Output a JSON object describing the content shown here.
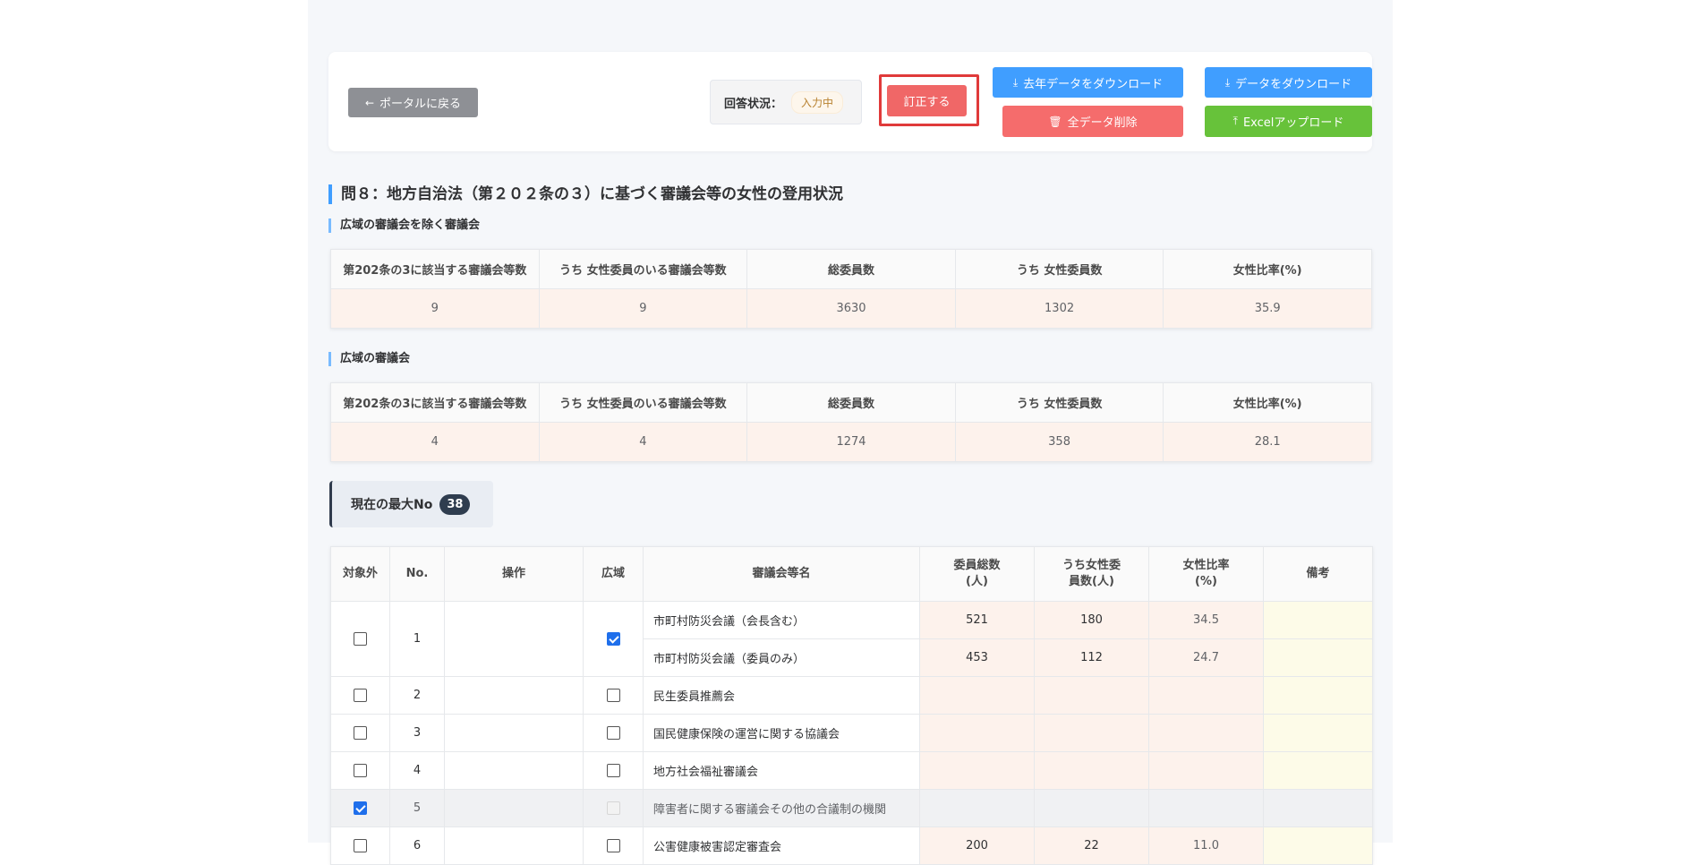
{
  "toolbar": {
    "back_label": "ポータルに戻る",
    "status_label": "回答状況：",
    "status_value": "入力中",
    "correct_label": "訂正する",
    "download_last_year_label": "去年データをダウンロード",
    "delete_all_label": "全データ削除",
    "download_label": "データをダウンロード",
    "excel_upload_label": "Excelアップロード"
  },
  "section": {
    "title": "問８：地方自治法（第２０２条の３）に基づく審議会等の女性の登用状況"
  },
  "summary_headers": [
    "第202条の3に該当する審議会等数",
    "うち 女性委員のいる審議会等数",
    "総委員数",
    "うち 女性委員数",
    "女性比率(%)"
  ],
  "summary_non_wide": {
    "title": "広域の審議会を除く審議会",
    "values": [
      "9",
      "9",
      "3630",
      "1302",
      "35.9"
    ]
  },
  "summary_wide": {
    "title": "広域の審議会",
    "values": [
      "4",
      "4",
      "1274",
      "358",
      "28.1"
    ]
  },
  "max_no": {
    "label": "現在の最大No",
    "value": "38"
  },
  "main_table": {
    "headers": {
      "excluded": "対象外",
      "no": "No.",
      "ops": "操作",
      "wide": "広域",
      "name": "審議会等名",
      "total_line1": "委員総数",
      "total_line2": "(人)",
      "female_line1": "うち女性委",
      "female_line2": "員数(人)",
      "rate_line1": "女性比率",
      "rate_line2": "(%)",
      "note": "備考"
    },
    "rows": [
      {
        "no": "1",
        "excluded": false,
        "wide": true,
        "name_a": "市町村防災会議（会長含む）",
        "total_a": "521",
        "female_a": "180",
        "rate_a": "34.5",
        "name_b": "市町村防災会議（委員のみ）",
        "total_b": "453",
        "female_b": "112",
        "rate_b": "24.7"
      },
      {
        "no": "2",
        "excluded": false,
        "wide": false,
        "name": "民生委員推薦会",
        "total": "",
        "female": "",
        "rate": ""
      },
      {
        "no": "3",
        "excluded": false,
        "wide": false,
        "name": "国民健康保険の運営に関する協議会",
        "total": "",
        "female": "",
        "rate": ""
      },
      {
        "no": "4",
        "excluded": false,
        "wide": false,
        "name": "地方社会福祉審議会",
        "total": "",
        "female": "",
        "rate": ""
      },
      {
        "no": "5",
        "excluded": true,
        "wide": false,
        "name": "障害者に関する審議会その他の合議制の機関",
        "total": "",
        "female": "",
        "rate": ""
      },
      {
        "no": "6",
        "excluded": false,
        "wide": false,
        "name": "公害健康被害認定審査会",
        "total": "200",
        "female": "22",
        "rate": "11.0"
      }
    ]
  },
  "colors": {
    "primary": "#409eff",
    "danger": "#f56c6c",
    "success": "#67c23a",
    "highlight_frame": "#e03a3a",
    "input_cell": "#fdf2ec",
    "note_cell": "#fdfbe8"
  }
}
